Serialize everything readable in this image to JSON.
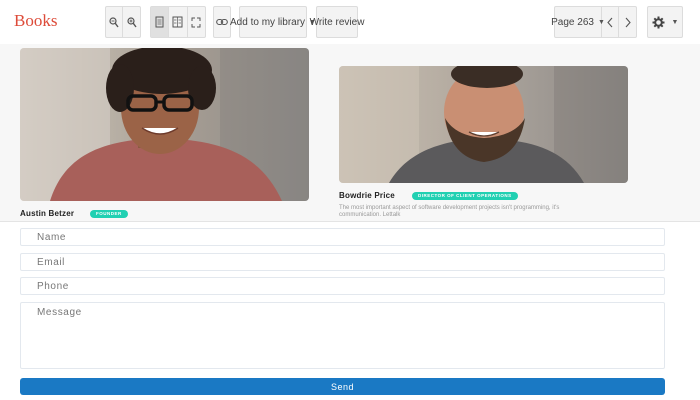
{
  "toolbar": {
    "brand": "Books",
    "add_library_label": "Add to my library",
    "write_review_label": "Write review",
    "page_label": "Page 263"
  },
  "page": {
    "person1": {
      "name": "Austin Betzer",
      "badge": "FOUNDER"
    },
    "person2": {
      "name": "Bowdrie Price",
      "badge": "DIRECTOR OF CLIENT OPERATIONS",
      "bio": "The most important aspect of software development projects isn't programming, it's communication. Lettalk"
    }
  },
  "form": {
    "name_placeholder": "Name",
    "email_placeholder": "Email",
    "phone_placeholder": "Phone",
    "message_placeholder": "Message",
    "send_label": "Send"
  }
}
